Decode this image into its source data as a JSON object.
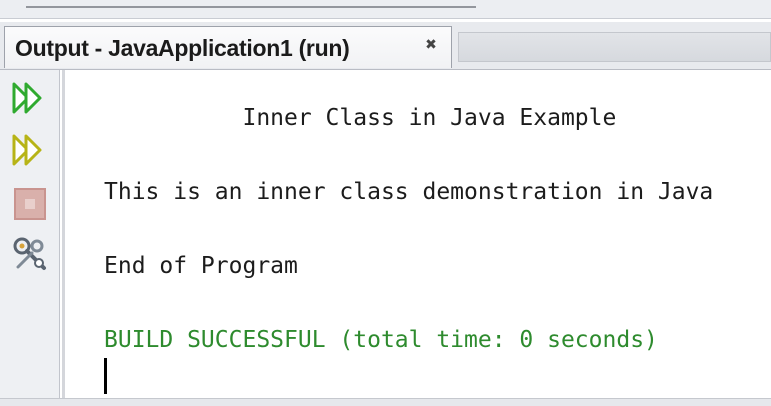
{
  "panel": {
    "tab_title": "Output - JavaApplication1 (run)",
    "close_glyph": "✖"
  },
  "toolbar": {
    "buttons": [
      {
        "name": "rerun-icon",
        "color": "#2faa2f"
      },
      {
        "name": "rerun-with-options-icon",
        "color": "#b7b417"
      },
      {
        "name": "stop-icon",
        "color": "#c9948f"
      },
      {
        "name": "settings-icon",
        "color": "#5a6470"
      }
    ]
  },
  "output": {
    "lines": [
      "          Inner Class in Java Example",
      "This is an inner class demonstration in Java",
      "End of Program",
      "BUILD SUCCESSFUL (total time: 0 seconds)"
    ]
  }
}
